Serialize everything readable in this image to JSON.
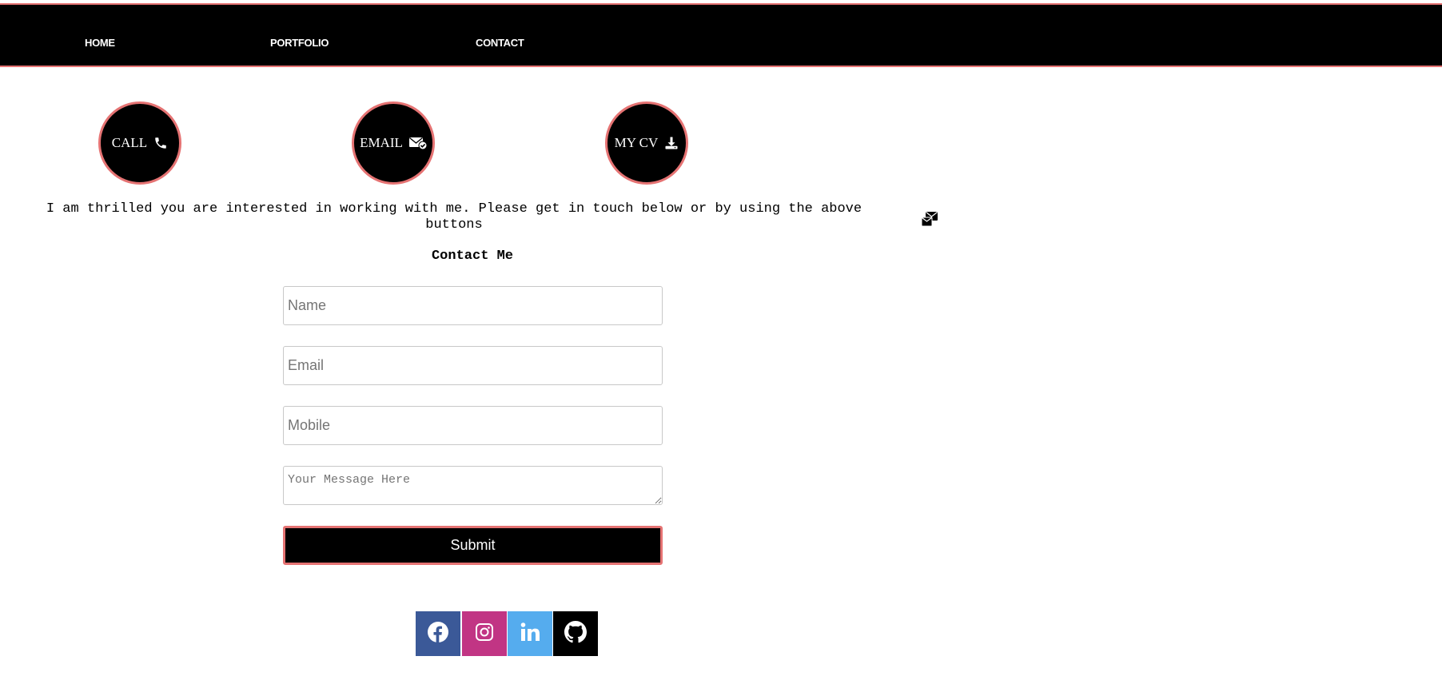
{
  "nav": {
    "items": [
      {
        "label": "HOME"
      },
      {
        "label": "PORTFOLIO"
      },
      {
        "label": "CONTACT"
      }
    ]
  },
  "actions": {
    "call": {
      "label": "CALL",
      "icon": "phone-icon"
    },
    "email": {
      "label": "EMAIL",
      "icon": "envelope-check-icon"
    },
    "cv": {
      "label": "MY CV",
      "icon": "download-icon"
    }
  },
  "intro_text": "I am thrilled you are interested in working with me. Please get in touch below or by using the above buttons",
  "form": {
    "title": "Contact Me",
    "name_placeholder": "Name",
    "email_placeholder": "Email",
    "mobile_placeholder": "Mobile",
    "message_placeholder": "Your Message Here",
    "submit_label": "Submit"
  },
  "social": [
    {
      "name": "facebook-icon",
      "color": "#3b5998"
    },
    {
      "name": "instagram-icon",
      "color": "#c13584"
    },
    {
      "name": "linkedin-icon",
      "color": "#55acee"
    },
    {
      "name": "github-icon",
      "color": "#000000"
    }
  ],
  "colors": {
    "accent": "#e57373",
    "nav_bg": "#000000",
    "button_bg": "#000000",
    "text_light": "#ffffff"
  }
}
